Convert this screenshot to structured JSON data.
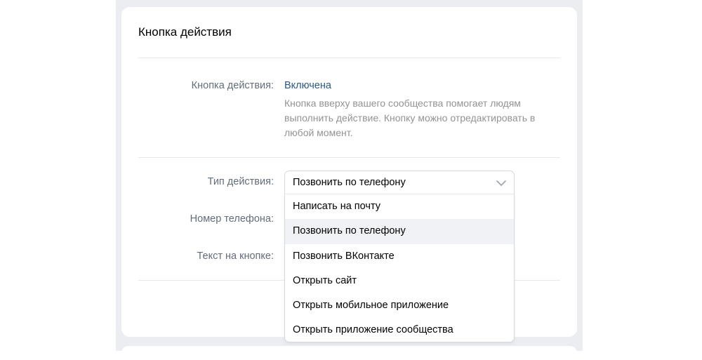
{
  "card": {
    "title": "Кнопка действия"
  },
  "status_row": {
    "label": "Кнопка действия:",
    "value": "Включена",
    "description": "Кнопка вверху вашего сообщества помогает людям выполнить действие. Кнопку можно отредактировать в любой момент."
  },
  "form": {
    "action_type_label": "Тип действия:",
    "phone_label": "Номер телефона:",
    "button_text_label": "Текст на кнопке:"
  },
  "select": {
    "selected_value": "Позвонить по телефону",
    "options": [
      "Написать на почту",
      "Позвонить по телефону",
      "Позвонить ВКонтакте",
      "Открыть сайт",
      "Открыть мобильное приложение",
      "Открыть приложение сообщества"
    ],
    "highlighted_option": "Позвонить по телефону"
  },
  "colors": {
    "page_band": "#ebedf0",
    "link_blue": "#2a5885",
    "label_gray": "#626d7a",
    "hint_gray": "#939393",
    "hover_bg": "#f0f2f5"
  }
}
